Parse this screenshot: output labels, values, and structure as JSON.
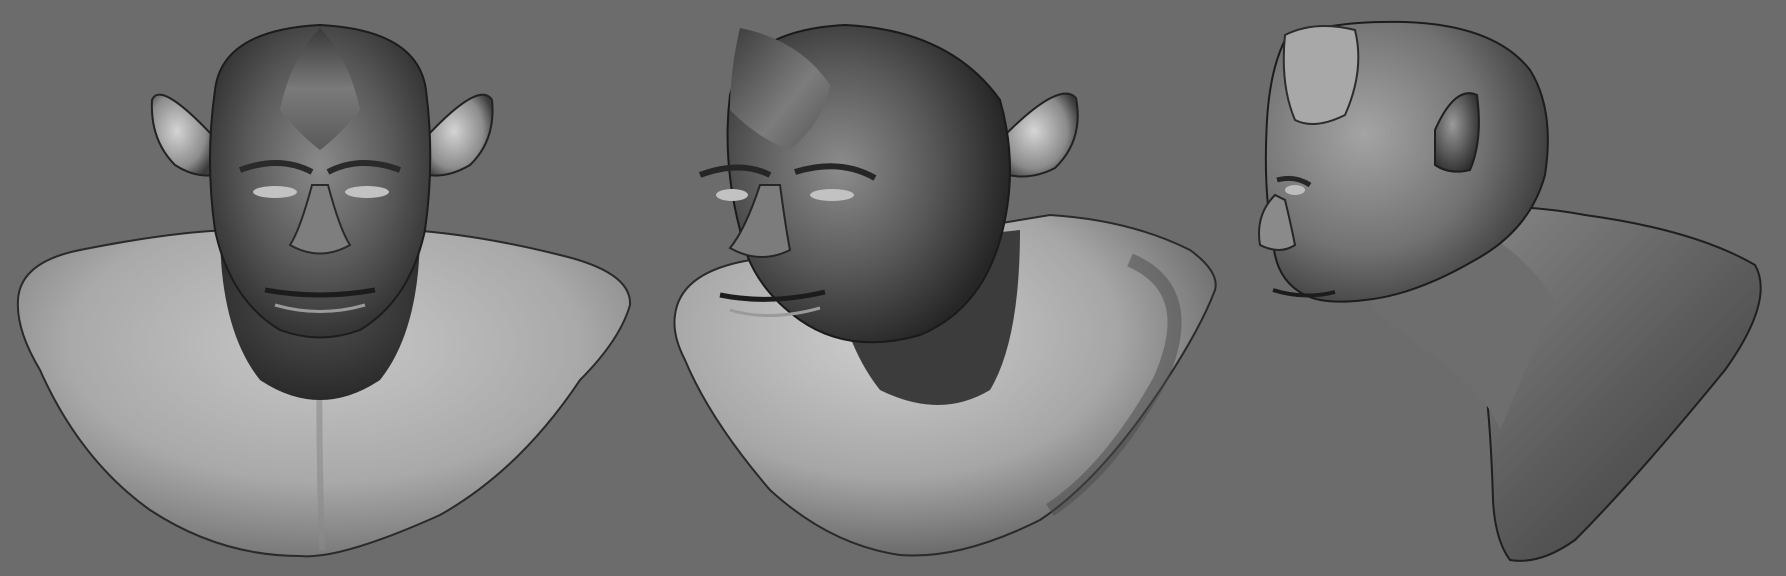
{
  "scene": {
    "background_color": "#6c6c6c",
    "views": [
      {
        "id": "front",
        "name": "front-view"
      },
      {
        "id": "threequarter",
        "name": "three-quarter-view"
      },
      {
        "id": "side",
        "name": "side-profile-view"
      }
    ],
    "colors": {
      "skin_light": "#c9c9c9",
      "skin_mid": "#8f8f8f",
      "skin_dark": "#3a3a3a",
      "shadow": "#1e1e1e"
    }
  }
}
